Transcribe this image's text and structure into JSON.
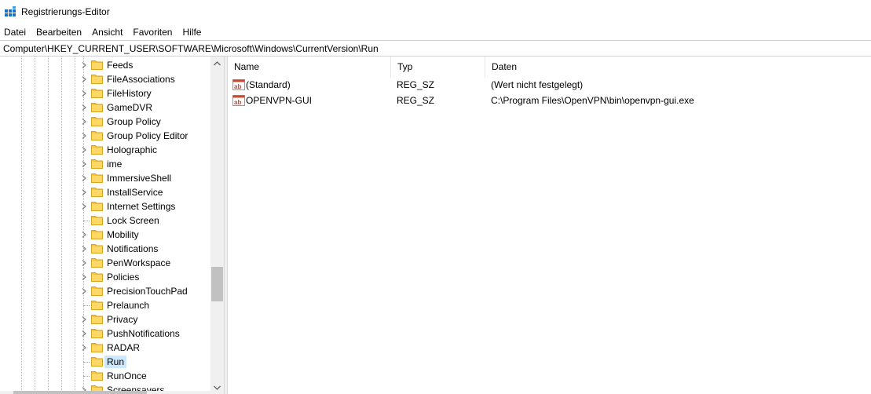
{
  "window": {
    "title": "Registrierungs-Editor",
    "icon": "regedit-icon"
  },
  "menu": {
    "items": [
      "Datei",
      "Bearbeiten",
      "Ansicht",
      "Favoriten",
      "Hilfe"
    ]
  },
  "address": {
    "value": "Computer\\HKEY_CURRENT_USER\\SOFTWARE\\Microsoft\\Windows\\CurrentVersion\\Run"
  },
  "tree": {
    "items": [
      {
        "label": "Feeds",
        "expandable": true
      },
      {
        "label": "FileAssociations",
        "expandable": true
      },
      {
        "label": "FileHistory",
        "expandable": true
      },
      {
        "label": "GameDVR",
        "expandable": true
      },
      {
        "label": "Group Policy",
        "expandable": true
      },
      {
        "label": "Group Policy Editor",
        "expandable": true
      },
      {
        "label": "Holographic",
        "expandable": true
      },
      {
        "label": "ime",
        "expandable": true
      },
      {
        "label": "ImmersiveShell",
        "expandable": true
      },
      {
        "label": "InstallService",
        "expandable": true
      },
      {
        "label": "Internet Settings",
        "expandable": true
      },
      {
        "label": "Lock Screen",
        "expandable": false
      },
      {
        "label": "Mobility",
        "expandable": true
      },
      {
        "label": "Notifications",
        "expandable": true
      },
      {
        "label": "PenWorkspace",
        "expandable": true
      },
      {
        "label": "Policies",
        "expandable": true
      },
      {
        "label": "PrecisionTouchPad",
        "expandable": true
      },
      {
        "label": "Prelaunch",
        "expandable": false
      },
      {
        "label": "Privacy",
        "expandable": true
      },
      {
        "label": "PushNotifications",
        "expandable": true
      },
      {
        "label": "RADAR",
        "expandable": true
      },
      {
        "label": "Run",
        "expandable": false,
        "selected": true
      },
      {
        "label": "RunOnce",
        "expandable": false
      },
      {
        "label": "Screensavers",
        "expandable": true
      }
    ]
  },
  "values": {
    "columns": {
      "name": "Name",
      "type": "Typ",
      "data": "Daten"
    },
    "rows": [
      {
        "name": "(Standard)",
        "type": "REG_SZ",
        "data": "(Wert nicht festgelegt)",
        "icon": "reg-string-icon"
      },
      {
        "name": "OPENVPN-GUI",
        "type": "REG_SZ",
        "data": "C:\\Program Files\\OpenVPN\\bin\\openvpn-gui.exe",
        "icon": "reg-string-icon"
      }
    ]
  },
  "colors": {
    "selection": "#cce8ff",
    "folder": "#f5c542",
    "scrollbar": "#f0f0f0"
  }
}
